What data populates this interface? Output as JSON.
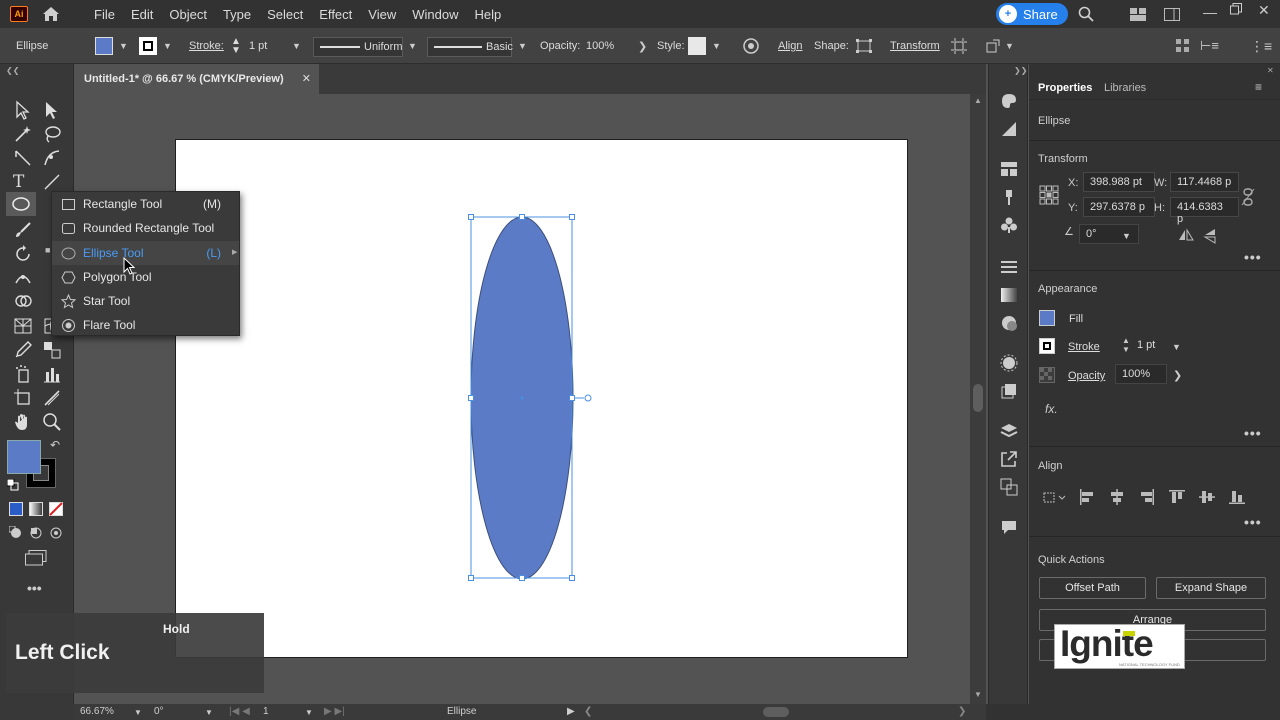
{
  "menubar": {
    "app_badge": "Ai",
    "items": [
      "File",
      "Edit",
      "Object",
      "Type",
      "Select",
      "Effect",
      "View",
      "Window",
      "Help"
    ],
    "share_label": "Share"
  },
  "controlbar": {
    "object_type": "Ellipse",
    "fill_color": "#5b7bc6",
    "stroke_label": "Stroke:",
    "stroke_value": "1 pt",
    "profile_label": "Uniform",
    "brush_label": "Basic",
    "opacity_label": "Opacity:",
    "opacity_value": "100%",
    "style_label": "Style:",
    "align_label": "Align",
    "shape_label": "Shape:",
    "transform_label": "Transform"
  },
  "document_tab": {
    "title": "Untitled-1* @ 66.67 % (CMYK/Preview)",
    "close": "✕"
  },
  "flyout": {
    "items": [
      {
        "label": "Rectangle Tool",
        "shortcut": "(M)",
        "icon": "rectangle-icon"
      },
      {
        "label": "Rounded Rectangle Tool",
        "shortcut": "",
        "icon": "rounded-rectangle-icon"
      },
      {
        "label": "Ellipse Tool",
        "shortcut": "(L)",
        "icon": "ellipse-icon"
      },
      {
        "label": "Polygon Tool",
        "shortcut": "",
        "icon": "polygon-icon"
      },
      {
        "label": "Star Tool",
        "shortcut": "",
        "icon": "star-icon"
      },
      {
        "label": "Flare Tool",
        "shortcut": "",
        "icon": "flare-icon"
      }
    ]
  },
  "properties": {
    "tab_active": "Properties",
    "tab_inactive": "Libraries",
    "object_type": "Ellipse",
    "transform_title": "Transform",
    "x_label": "X:",
    "x_value": "398.988 pt",
    "y_label": "Y:",
    "y_value": "297.6378 p",
    "w_label": "W:",
    "w_value": "117.4468 p",
    "h_label": "H:",
    "h_value": "414.6383 p",
    "angle_value": "0°",
    "appearance_title": "Appearance",
    "fill_label": "Fill",
    "stroke_label": "Stroke",
    "stroke_value": "1 pt",
    "opacity_label": "Opacity",
    "opacity_value": "100%",
    "fx_label": "fx.",
    "align_title": "Align",
    "quick_actions_title": "Quick Actions",
    "offset_path_label": "Offset Path",
    "expand_shape_label": "Expand Shape",
    "arrange_label": "Arrange",
    "more": "•••"
  },
  "statusbar": {
    "zoom": "66.67%",
    "rotation": "0°",
    "artboard": "1",
    "selection_tool": "Ellipse"
  },
  "overlay": {
    "click_label": "Left Click",
    "hold_label": "Hold"
  },
  "watermark": {
    "text": "Ignite",
    "sub": "NATIONAL TECHNOLOGY FUND"
  },
  "colors": {
    "accent": "#2680eb",
    "fill": "#5b7bc6",
    "selection": "#4a90e2"
  }
}
